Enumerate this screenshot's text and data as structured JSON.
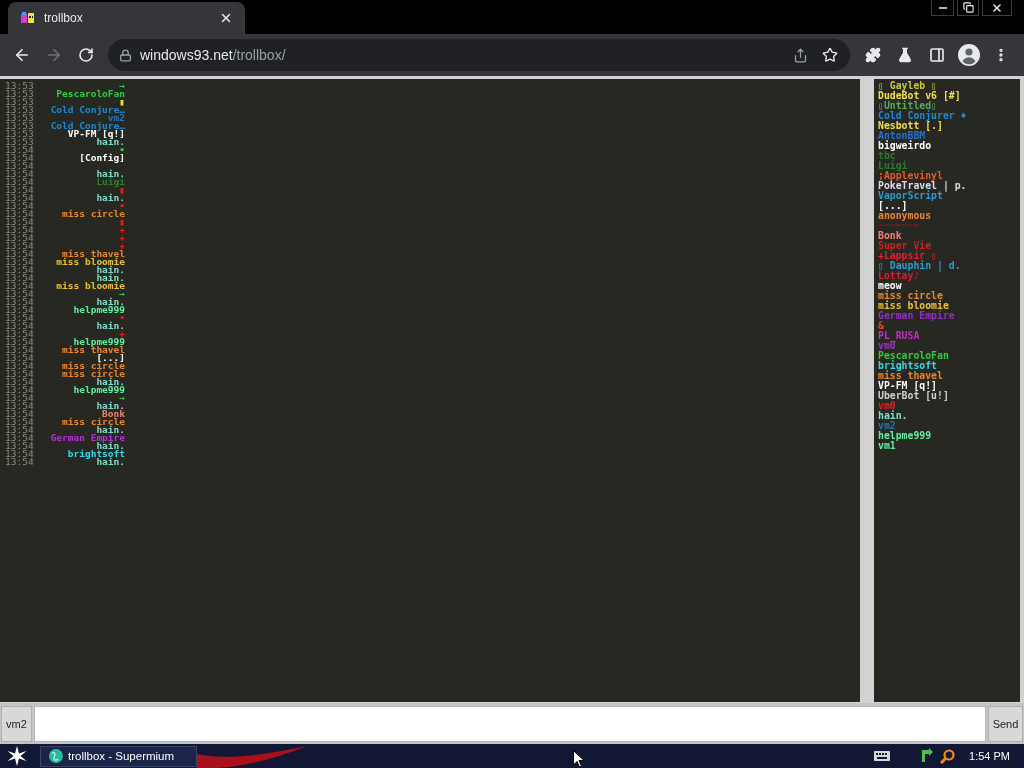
{
  "browser": {
    "tab": {
      "title": "trollbox"
    },
    "nav": {
      "back": {
        "disabled": false
      },
      "forward": {
        "disabled": true
      }
    },
    "address": {
      "host": "windows93.net",
      "path": "/trollbox/"
    }
  },
  "chat": {
    "messages": [
      {
        "time": "13:53",
        "nick": "→",
        "color": "#2ecc40"
      },
      {
        "time": "13:53",
        "nick": "PescaroloFan",
        "color": "#2ecc40"
      },
      {
        "time": "13:53",
        "nick": "▮",
        "color": "#e6e62e"
      },
      {
        "time": "13:53",
        "nick": "Cold Conjure…",
        "color": "#1e88d0"
      },
      {
        "time": "13:53",
        "nick": "vm2",
        "color": "#2a6fb0"
      },
      {
        "time": "13:53",
        "nick": "Cold Conjure…",
        "color": "#1e88d0"
      },
      {
        "time": "13:53",
        "nick": "VP-FM [q!]",
        "color": "#ffffff"
      },
      {
        "time": "13:53",
        "nick": "hain.",
        "color": "#7fdcc8"
      },
      {
        "time": "13:54",
        "nick": "•",
        "color": "#3ec43e"
      },
      {
        "time": "13:54",
        "nick": "[Config]",
        "color": "#ffffff"
      },
      {
        "time": "13:54"
      },
      {
        "time": "13:54",
        "nick": "hain.",
        "color": "#7fdcc8"
      },
      {
        "time": "13:54",
        "nick": "Luigi",
        "color": "#2f7d2f"
      },
      {
        "time": "13:54",
        "nick": "▮",
        "color": "#e02020"
      },
      {
        "time": "13:54",
        "nick": "hain.",
        "color": "#7fdcc8"
      },
      {
        "time": "13:54",
        "nick": "•",
        "color": "#e02020"
      },
      {
        "time": "13:54",
        "nick": "miss circle",
        "color": "#e8862a"
      },
      {
        "time": "13:54",
        "nick": "▮",
        "color": "#e02020"
      },
      {
        "time": "13:54",
        "nick": "+",
        "color": "#e02020"
      },
      {
        "time": "13:54",
        "nick": "+",
        "color": "#e02020"
      },
      {
        "time": "13:54",
        "nick": "+",
        "color": "#e02020"
      },
      {
        "time": "13:54",
        "nick": "miss thavel",
        "color": "#e8862a"
      },
      {
        "time": "13:54",
        "nick": "miss bloomie",
        "color": "#e8c030"
      },
      {
        "time": "13:54",
        "nick": "hain.",
        "color": "#7fdcc8"
      },
      {
        "time": "13:54",
        "nick": "hain.",
        "color": "#7fdcc8"
      },
      {
        "time": "13:54",
        "nick": "miss bloomie",
        "color": "#e8c030"
      },
      {
        "time": "13:54",
        "nick": "→",
        "color": "#2ecc40"
      },
      {
        "time": "13:54",
        "nick": "hain.",
        "color": "#7fdcc8"
      },
      {
        "time": "13:54",
        "nick": "helpme999",
        "color": "#5ef0a0"
      },
      {
        "time": "13:54",
        "nick": "•",
        "color": "#e02020"
      },
      {
        "time": "13:54",
        "nick": "hain.",
        "color": "#7fdcc8"
      },
      {
        "time": "13:54",
        "nick": "+",
        "color": "#e02020"
      },
      {
        "time": "13:54",
        "nick": "helpme999",
        "color": "#5ef0a0"
      },
      {
        "time": "13:54",
        "nick": "miss thavel",
        "color": "#e8862a"
      },
      {
        "time": "13:54",
        "nick": "[...]",
        "color": "#ffffff"
      },
      {
        "time": "13:54",
        "nick": "miss circle",
        "color": "#e8862a"
      },
      {
        "time": "13:54",
        "nick": "miss circle",
        "color": "#e8862a"
      },
      {
        "time": "13:54",
        "nick": "hain.",
        "color": "#7fdcc8"
      },
      {
        "time": "13:54",
        "nick": "helpme999",
        "color": "#5ef0a0"
      },
      {
        "time": "13:54",
        "nick": "→",
        "color": "#2ecc40"
      },
      {
        "time": "13:54",
        "nick": "hain.",
        "color": "#7fdcc8"
      },
      {
        "time": "13:54",
        "nick": "Bonk",
        "color": "#f08070"
      },
      {
        "time": "13:54",
        "nick": "miss circle",
        "color": "#e8862a"
      },
      {
        "time": "13:54",
        "nick": "hain.",
        "color": "#7fdcc8"
      },
      {
        "time": "13:54",
        "nick": "German Empire",
        "color": "#b030d0"
      },
      {
        "time": "13:54",
        "nick": "hain.",
        "color": "#7fdcc8"
      },
      {
        "time": "13:54",
        "nick": "brightsoft",
        "color": "#30d8e8"
      },
      {
        "time": "13:54",
        "nick": "hain.",
        "color": "#7fdcc8"
      }
    ]
  },
  "users": [
    {
      "name": "▯ Gayleb ▯",
      "color": "#c8c830"
    },
    {
      "name": "DudeBot v6 [#]",
      "color": "#f0e040"
    },
    {
      "name": "▯Untitled▯",
      "color": "#58a858"
    },
    {
      "name": "Cold Conjurer ♦",
      "color": "#1e88d0"
    },
    {
      "name": "Nesbott [.]",
      "color": "#f0e040"
    },
    {
      "name": "AntonBBM",
      "color": "#2a70c8"
    },
    {
      "name": "bigweirdo",
      "color": "#ffffff"
    },
    {
      "name": "tbc",
      "color": "#2a7a2a"
    },
    {
      "name": "Luigi",
      "color": "#2a7a2a"
    },
    {
      "name": ";Applevinyl",
      "color": "#e05a2a"
    },
    {
      "name": "PokeTravel | p.",
      "color": "#e0d8e8"
    },
    {
      "name": "VaporScript",
      "color": "#2a9ad0"
    },
    {
      "name": "[...]",
      "color": "#ffffff"
    },
    {
      "name": "anonymous",
      "color": "#e8862a"
    },
    {
      "name": "~~~~~~~",
      "color": "#8a1a1a"
    },
    {
      "name": "Bonk",
      "color": "#f08070"
    },
    {
      "name": "Super Vie",
      "color": "#d02020"
    },
    {
      "name": "+Lappsir ▯",
      "color": "#e02030"
    },
    {
      "name": "▯ Dauphin | d.",
      "color": "#2a9ad0"
    },
    {
      "name": "Lottay♪",
      "color": "#d02030"
    },
    {
      "name": "meow",
      "color": "#ffffff"
    },
    {
      "name": "miss circle",
      "color": "#e8862a"
    },
    {
      "name": "miss bloomie",
      "color": "#e8c030"
    },
    {
      "name": "German Empire",
      "color": "#9030c0"
    },
    {
      "name": "&",
      "color": "#e04020"
    },
    {
      "name": "PL_RUSA",
      "color": "#c030c0"
    },
    {
      "name": "vm0",
      "color": "#a030c0"
    },
    {
      "name": "PescaroloFan",
      "color": "#2ecc40"
    },
    {
      "name": "brightsoft",
      "color": "#30d8e8"
    },
    {
      "name": "miss thavel",
      "color": "#e8862a"
    },
    {
      "name": "VP-FM [q!]",
      "color": "#ffffff"
    },
    {
      "name": "UberBot [u!]",
      "color": "#d0d0d0"
    },
    {
      "name": "vm0",
      "color": "#e02020"
    },
    {
      "name": "hain.",
      "color": "#7fdcc8"
    },
    {
      "name": "vm2",
      "color": "#2a6fb0"
    },
    {
      "name": "helpme999",
      "color": "#5ef0a0"
    },
    {
      "name": "vm1",
      "color": "#5ef0a0"
    }
  ],
  "composer": {
    "nick": "vm2",
    "send": "Send"
  },
  "taskbar": {
    "task": "trollbox - Supermium",
    "clock": "1:54 PM"
  }
}
